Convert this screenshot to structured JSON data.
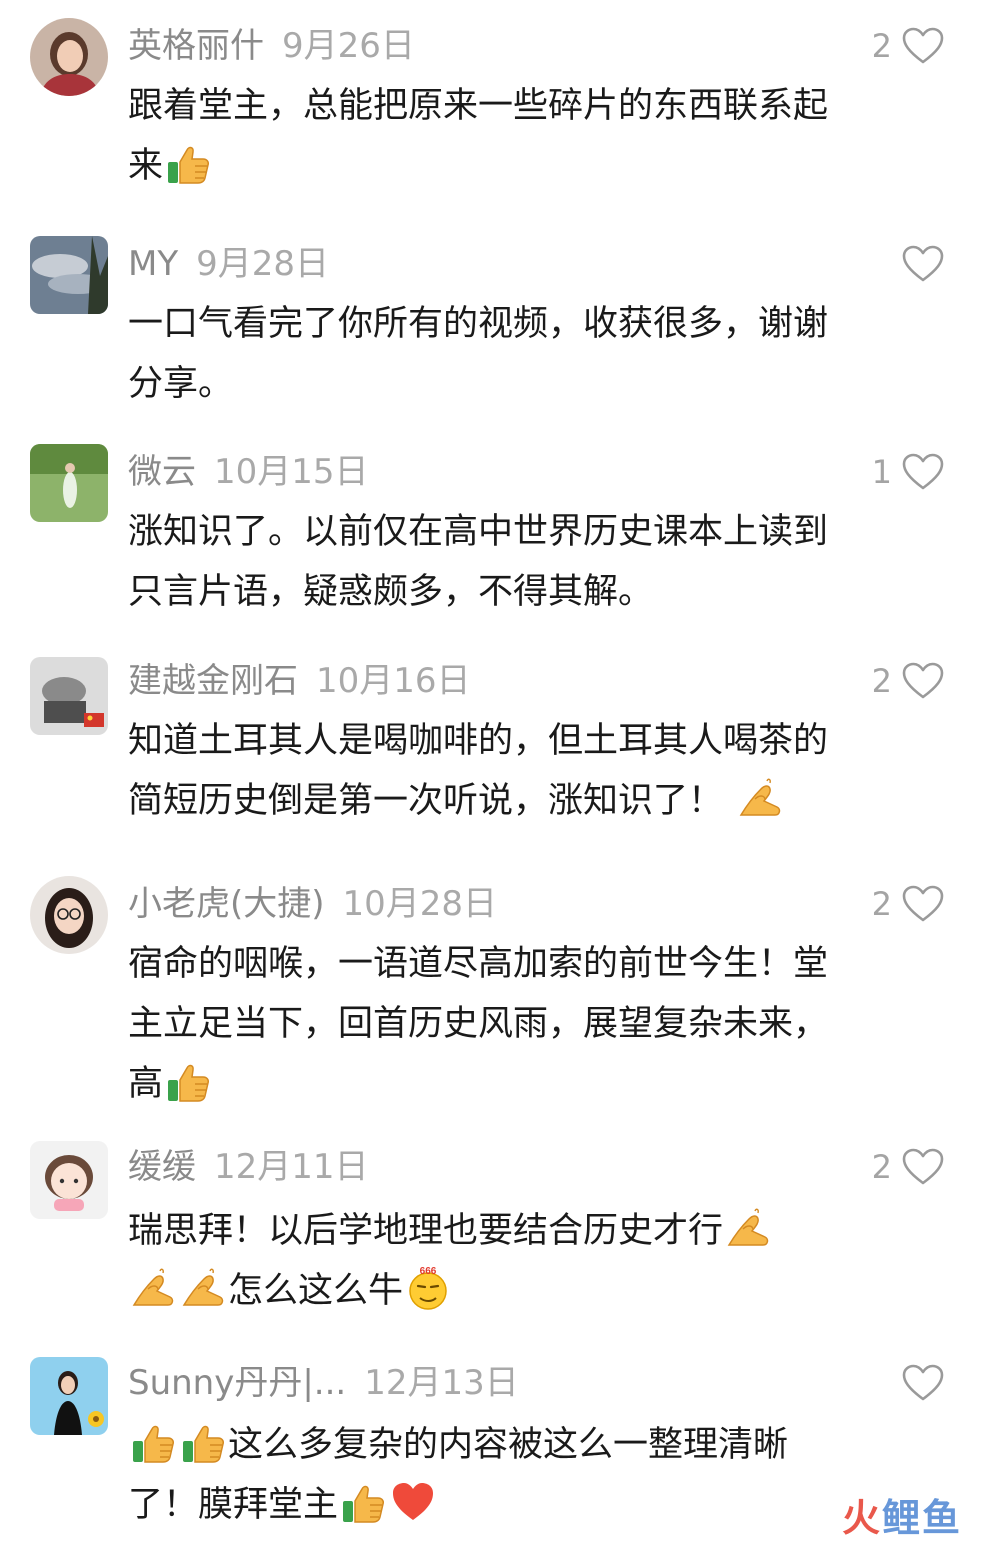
{
  "colors": {
    "username": "#8a8a8a",
    "date": "#a9a9a9",
    "text": "#1a1a1a",
    "heart_outline": "#9a9a9a",
    "watermark_red": "#e84a3c",
    "watermark_blue": "#5b8fd6"
  },
  "comments": [
    {
      "username": "英格丽什",
      "date": "9月26日",
      "likes": "2",
      "avatar": "woman-portrait-avatar",
      "text": [
        "跟着堂主，总能把原来一些碎片的东西联系起来"
      ],
      "emojis": [
        "thumbs-up-emoji"
      ]
    },
    {
      "username": "MY",
      "date": "9月28日",
      "likes": "",
      "avatar": "sky-photo-avatar",
      "text": [
        "一口气看完了你所有的视频，收获很多，谢谢分享。"
      ],
      "emojis": []
    },
    {
      "username": "微云",
      "date": "10月15日",
      "likes": "1",
      "avatar": "field-photo-avatar",
      "text": [
        "涨知识了。以前仅在高中世界历史课本上读到只言片语，疑惑颇多，不得其解。"
      ],
      "emojis": []
    },
    {
      "username": "建越金刚石",
      "date": "10月16日",
      "likes": "2",
      "avatar": "machine-photo-avatar",
      "text": [
        "知道土耳其人是喝咖啡的，但土耳其人喝茶的简短历史倒是第一次听说，涨知识了！"
      ],
      "emojis": [
        "ok-hand-emoji"
      ]
    },
    {
      "username": "小老虎(大捷)",
      "date": "10月28日",
      "likes": "2",
      "avatar": "girl-glasses-avatar",
      "text": [
        "宿命的咽喉，一语道尽高加索的前世今生！堂主立足当下，回首历史风雨，展望复杂未来，高"
      ],
      "emojis": [
        "thumbs-up-emoji"
      ]
    },
    {
      "username": "缓缓",
      "date": "12月11日",
      "likes": "2",
      "avatar": "cartoon-girl-avatar",
      "text": [
        "瑞思拜！以后学地理也要结合历史才行",
        "怎么这么牛"
      ],
      "emojis": [
        "ok-hand-emoji",
        "ok-hand-emoji",
        "ok-hand-emoji",
        "666-emoji"
      ]
    },
    {
      "username": "Sunny丹丹|...",
      "date": "12月13日",
      "likes": "",
      "avatar": "woman-flowers-avatar",
      "text": [
        "这么多复杂的内容被这么一整理清晰了！膜拜堂主"
      ],
      "emojis": [
        "thumbs-up-emoji",
        "thumbs-up-emoji",
        "thumbs-up-emoji",
        "heart-emoji"
      ]
    }
  ],
  "watermark": {
    "part1": "火",
    "part2": "鲤鱼"
  }
}
